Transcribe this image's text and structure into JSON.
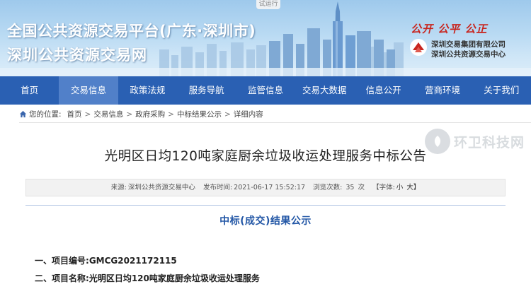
{
  "banner": {
    "trial_badge": "试运行",
    "title_line1": "全国公共资源交易平台(广东·深圳市)",
    "title_line2": "深圳公共资源交易网",
    "slogan": "公开 公平 公正",
    "org_name_1": "深圳交易集团有限公司",
    "org_name_2": "深圳公共资源交易中心",
    "colors": {
      "nav": "#2a60b3",
      "nav_active": "#5180c9",
      "slogan": "#c8251e",
      "section_title": "#2357a6"
    }
  },
  "nav": {
    "items": [
      {
        "label": "首页"
      },
      {
        "label": "交易信息"
      },
      {
        "label": "政策法规"
      },
      {
        "label": "服务导航"
      },
      {
        "label": "监管信息"
      },
      {
        "label": "交易大数据"
      },
      {
        "label": "信息公开"
      },
      {
        "label": "营商环境"
      },
      {
        "label": "关于我们"
      }
    ],
    "active_index": 1
  },
  "breadcrumb": {
    "prefix": "您的位置:",
    "items": [
      "首页",
      "交易信息",
      "政府采购",
      "中标结果公示",
      "详细内容"
    ],
    "separator": ">"
  },
  "watermark": {
    "text": "环卫科技网"
  },
  "article": {
    "title": "光明区日均120吨家庭厨余垃圾收运处理服务中标公告",
    "meta": {
      "source_label": "来源:",
      "source": "深圳公共资源交易中心",
      "published_label": "发布时间:",
      "published": "2021-06-17 15:52:17",
      "views_label": "浏览次数:",
      "views": "35",
      "views_unit": "次",
      "font_label": "【字体:",
      "font_small": "小",
      "font_large": "大】"
    },
    "section_title": "中标(成交)结果公示",
    "info": [
      {
        "label": "一、项目编号:",
        "value": "GMCG2021172115"
      },
      {
        "label": "二、项目名称:",
        "value": "光明区日均120吨家庭厨余垃圾收运处理服务"
      }
    ]
  }
}
